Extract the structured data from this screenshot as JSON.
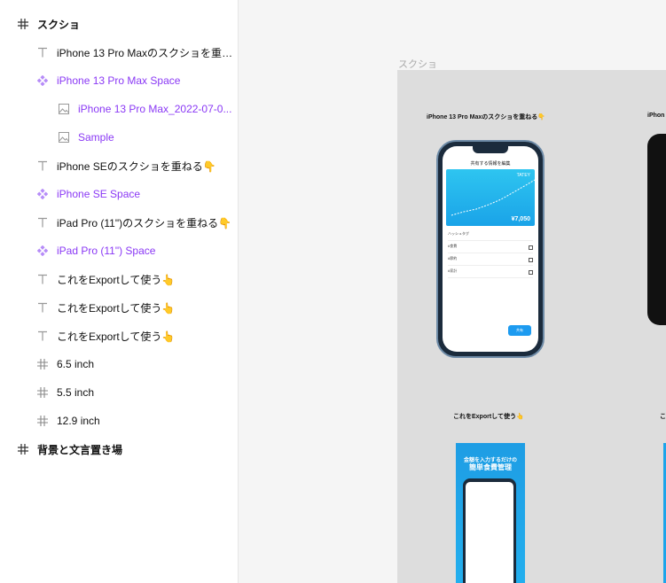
{
  "layers": [
    {
      "label": "スクショ",
      "icon": "frame-icon",
      "style": "bold"
    },
    {
      "label": "iPhone 13 Pro Maxのスクショを重ね...",
      "icon": "text-icon",
      "style": "normal"
    },
    {
      "label": "iPhone 13 Pro Max Space",
      "icon": "component-icon",
      "style": "purple"
    },
    {
      "label": "iPhone 13 Pro Max_2022-07-0...",
      "icon": "image-icon",
      "style": "purple"
    },
    {
      "label": "Sample",
      "icon": "image-icon",
      "style": "purple"
    },
    {
      "label": "iPhone SEのスクショを重ねる👇",
      "icon": "text-icon",
      "style": "normal"
    },
    {
      "label": "iPhone SE Space",
      "icon": "component-icon",
      "style": "purple"
    },
    {
      "label": "iPad Pro (11\")のスクショを重ねる👇",
      "icon": "text-icon",
      "style": "normal"
    },
    {
      "label": "iPad Pro (11\") Space",
      "icon": "component-icon",
      "style": "purple"
    },
    {
      "label": "これをExportして使う👆",
      "icon": "text-icon",
      "style": "normal"
    },
    {
      "label": "これをExportして使う👆",
      "icon": "text-icon",
      "style": "normal"
    },
    {
      "label": "これをExportして使う👆",
      "icon": "text-icon",
      "style": "normal"
    },
    {
      "label": "6.5 inch",
      "icon": "frame-icon",
      "style": "normal"
    },
    {
      "label": "5.5 inch",
      "icon": "frame-icon",
      "style": "normal"
    },
    {
      "label": "12.9 inch",
      "icon": "frame-icon",
      "style": "normal"
    },
    {
      "label": "背景と文言置き場",
      "icon": "frame-icon",
      "style": "bold"
    }
  ],
  "canvas": {
    "frame_label": "スクショ",
    "caption_top": "iPhone 13 Pro Maxのスクショを重ねる👇",
    "caption_top_right": "iPhon",
    "caption_bottom": "これをExportして使う👆",
    "caption_bottom_right": "こ",
    "phone": {
      "title": "共有する情報を編集",
      "brand": "TATEY",
      "price": "¥7,050",
      "section": "ハッシュタグ",
      "rows": [
        "#食費",
        "#節約",
        "#家計"
      ],
      "share_button": "共有"
    },
    "poster": {
      "line1": "金額を入力するだけの",
      "line2": "簡単食費管理"
    }
  },
  "colors": {
    "accent_purple": "#8a38f5",
    "chart_blue": "#2ec5f0"
  }
}
